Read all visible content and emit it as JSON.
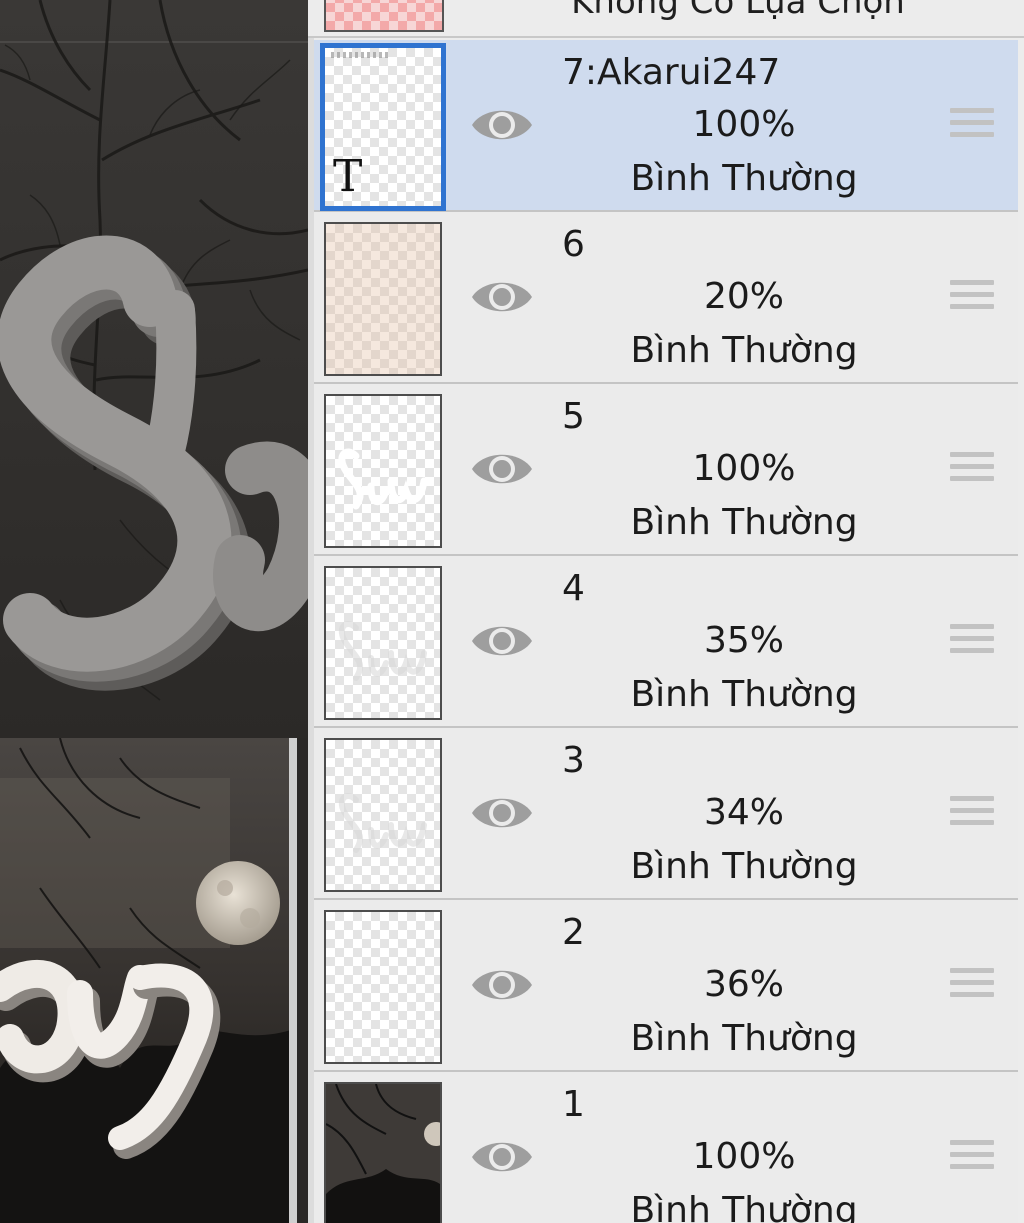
{
  "top_partial": {
    "selection_label": "Không Có Lựa Chọn"
  },
  "layers": [
    {
      "name": "7:Akarui247",
      "opacity": "100%",
      "blend": "Bình Thường",
      "selected": true,
      "thumb": "text-layer",
      "thumb_glyph": "T"
    },
    {
      "name": "6",
      "opacity": "20%",
      "blend": "Bình Thường",
      "selected": false,
      "thumb": "beige"
    },
    {
      "name": "5",
      "opacity": "100%",
      "blend": "Bình Thường",
      "selected": false,
      "thumb": "white-say"
    },
    {
      "name": "4",
      "opacity": "35%",
      "blend": "Bình Thường",
      "selected": false,
      "thumb": "faint-say"
    },
    {
      "name": "3",
      "opacity": "34%",
      "blend": "Bình Thường",
      "selected": false,
      "thumb": "faint-say"
    },
    {
      "name": "2",
      "opacity": "36%",
      "blend": "Bình Thường",
      "selected": false,
      "thumb": "empty"
    },
    {
      "name": "1",
      "opacity": "100%",
      "blend": "Bình Thường",
      "selected": false,
      "thumb": "photo"
    }
  ],
  "icons": {
    "visibility": "eye-icon",
    "drag": "drag-handle-icon",
    "text_layer": "text-layer-icon"
  },
  "colors": {
    "selected_row": "#cfdbee",
    "selected_border": "#2f73d0",
    "panel_bg": "#ebebeb"
  }
}
